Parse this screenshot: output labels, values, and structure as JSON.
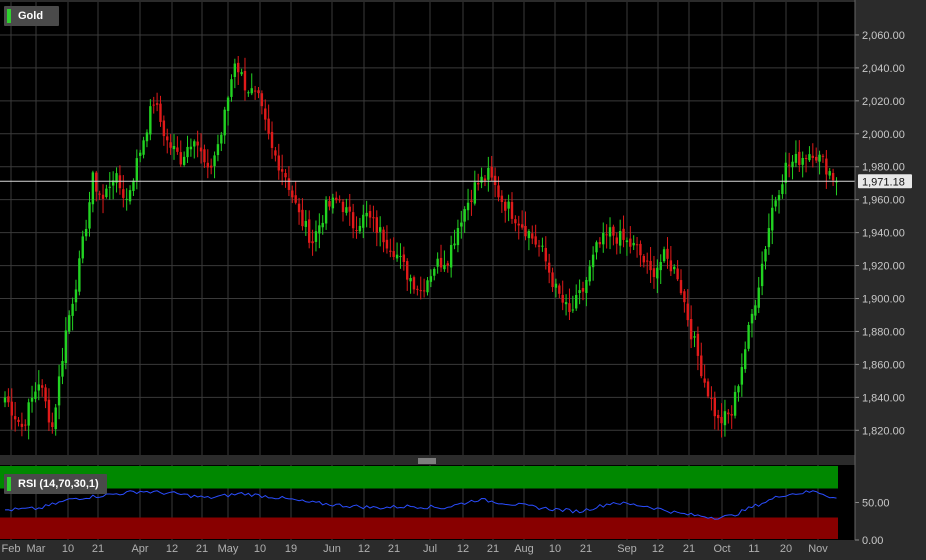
{
  "chart_data": [
    {
      "type": "candlestick",
      "title": "Gold",
      "last_price_label": "1,971.18",
      "last_price": 1971.18,
      "ylim": [
        1805,
        2080
      ],
      "y_ticks": [
        1820,
        1840,
        1860,
        1880,
        1900,
        1920,
        1940,
        1960,
        1980,
        2000,
        2020,
        2040,
        2060
      ],
      "y_tick_labels": [
        "1,820.00",
        "1,840.00",
        "1,860.00",
        "1,880.00",
        "1,900.00",
        "1,920.00",
        "1,940.00",
        "1,960.00",
        "1,980.00",
        "2,000.00",
        "2,020.00",
        "2,040.00",
        "2,060.00"
      ],
      "x_tick_labels": [
        "Feb",
        "Mar",
        "10",
        "21",
        "Apr",
        "12",
        "21",
        "May",
        "10",
        "19",
        "Jun",
        "12",
        "21",
        "Jul",
        "12",
        "21",
        "Aug",
        "10",
        "21",
        "Sep",
        "12",
        "21",
        "Oct",
        "11",
        "20",
        "Nov"
      ],
      "grid": true,
      "colors": {
        "up": "#22d322",
        "down": "#e01a1a",
        "grid": "#3a3a3a",
        "background": "#000000"
      },
      "close_anchors": [
        [
          0,
          1840
        ],
        [
          5,
          1822
        ],
        [
          10,
          1850
        ],
        [
          14,
          1822
        ],
        [
          18,
          1880
        ],
        [
          22,
          1920
        ],
        [
          26,
          1972
        ],
        [
          29,
          1960
        ],
        [
          32,
          1975
        ],
        [
          36,
          1960
        ],
        [
          40,
          1990
        ],
        [
          44,
          2020
        ],
        [
          48,
          1995
        ],
        [
          52,
          1985
        ],
        [
          56,
          2000
        ],
        [
          60,
          1975
        ],
        [
          64,
          2000
        ],
        [
          68,
          2045
        ],
        [
          71,
          2030
        ],
        [
          75,
          2020
        ],
        [
          79,
          1990
        ],
        [
          83,
          1975
        ],
        [
          87,
          1950
        ],
        [
          91,
          1935
        ],
        [
          95,
          1955
        ],
        [
          99,
          1960
        ],
        [
          103,
          1945
        ],
        [
          107,
          1950
        ],
        [
          111,
          1940
        ],
        [
          115,
          1930
        ],
        [
          119,
          1915
        ],
        [
          123,
          1905
        ],
        [
          127,
          1920
        ],
        [
          131,
          1925
        ],
        [
          135,
          1950
        ],
        [
          139,
          1968
        ],
        [
          143,
          1975
        ],
        [
          147,
          1960
        ],
        [
          151,
          1950
        ],
        [
          155,
          1940
        ],
        [
          159,
          1928
        ],
        [
          163,
          1905
        ],
        [
          167,
          1890
        ],
        [
          171,
          1905
        ],
        [
          175,
          1930
        ],
        [
          179,
          1940
        ],
        [
          183,
          1935
        ],
        [
          187,
          1930
        ],
        [
          191,
          1915
        ],
        [
          195,
          1925
        ],
        [
          199,
          1915
        ],
        [
          203,
          1880
        ],
        [
          207,
          1850
        ],
        [
          211,
          1825
        ],
        [
          215,
          1830
        ],
        [
          219,
          1870
        ],
        [
          223,
          1910
        ],
        [
          227,
          1955
        ],
        [
          231,
          1980
        ],
        [
          235,
          1985
        ],
        [
          239,
          1990
        ],
        [
          243,
          1980
        ],
        [
          246,
          1971
        ]
      ]
    },
    {
      "type": "line",
      "title": "RSI (14,70,30,1)",
      "ylim": [
        0,
        100
      ],
      "y_ticks": [
        0,
        50
      ],
      "y_tick_labels": [
        "0.00",
        "50.00"
      ],
      "bands": {
        "overbought": 70,
        "oversold": 30
      },
      "colors": {
        "line": "#2a4dff",
        "overbought": "#008800",
        "oversold": "#880000"
      },
      "anchors": [
        [
          0,
          40
        ],
        [
          10,
          42
        ],
        [
          20,
          55
        ],
        [
          30,
          60
        ],
        [
          40,
          65
        ],
        [
          50,
          62
        ],
        [
          60,
          56
        ],
        [
          70,
          62
        ],
        [
          80,
          57
        ],
        [
          90,
          50
        ],
        [
          100,
          46
        ],
        [
          110,
          43
        ],
        [
          120,
          45
        ],
        [
          130,
          43
        ],
        [
          140,
          54
        ],
        [
          150,
          48
        ],
        [
          160,
          42
        ],
        [
          170,
          38
        ],
        [
          180,
          50
        ],
        [
          190,
          45
        ],
        [
          200,
          35
        ],
        [
          210,
          30
        ],
        [
          215,
          32
        ],
        [
          220,
          42
        ],
        [
          230,
          60
        ],
        [
          240,
          65
        ],
        [
          246,
          55
        ]
      ]
    }
  ]
}
